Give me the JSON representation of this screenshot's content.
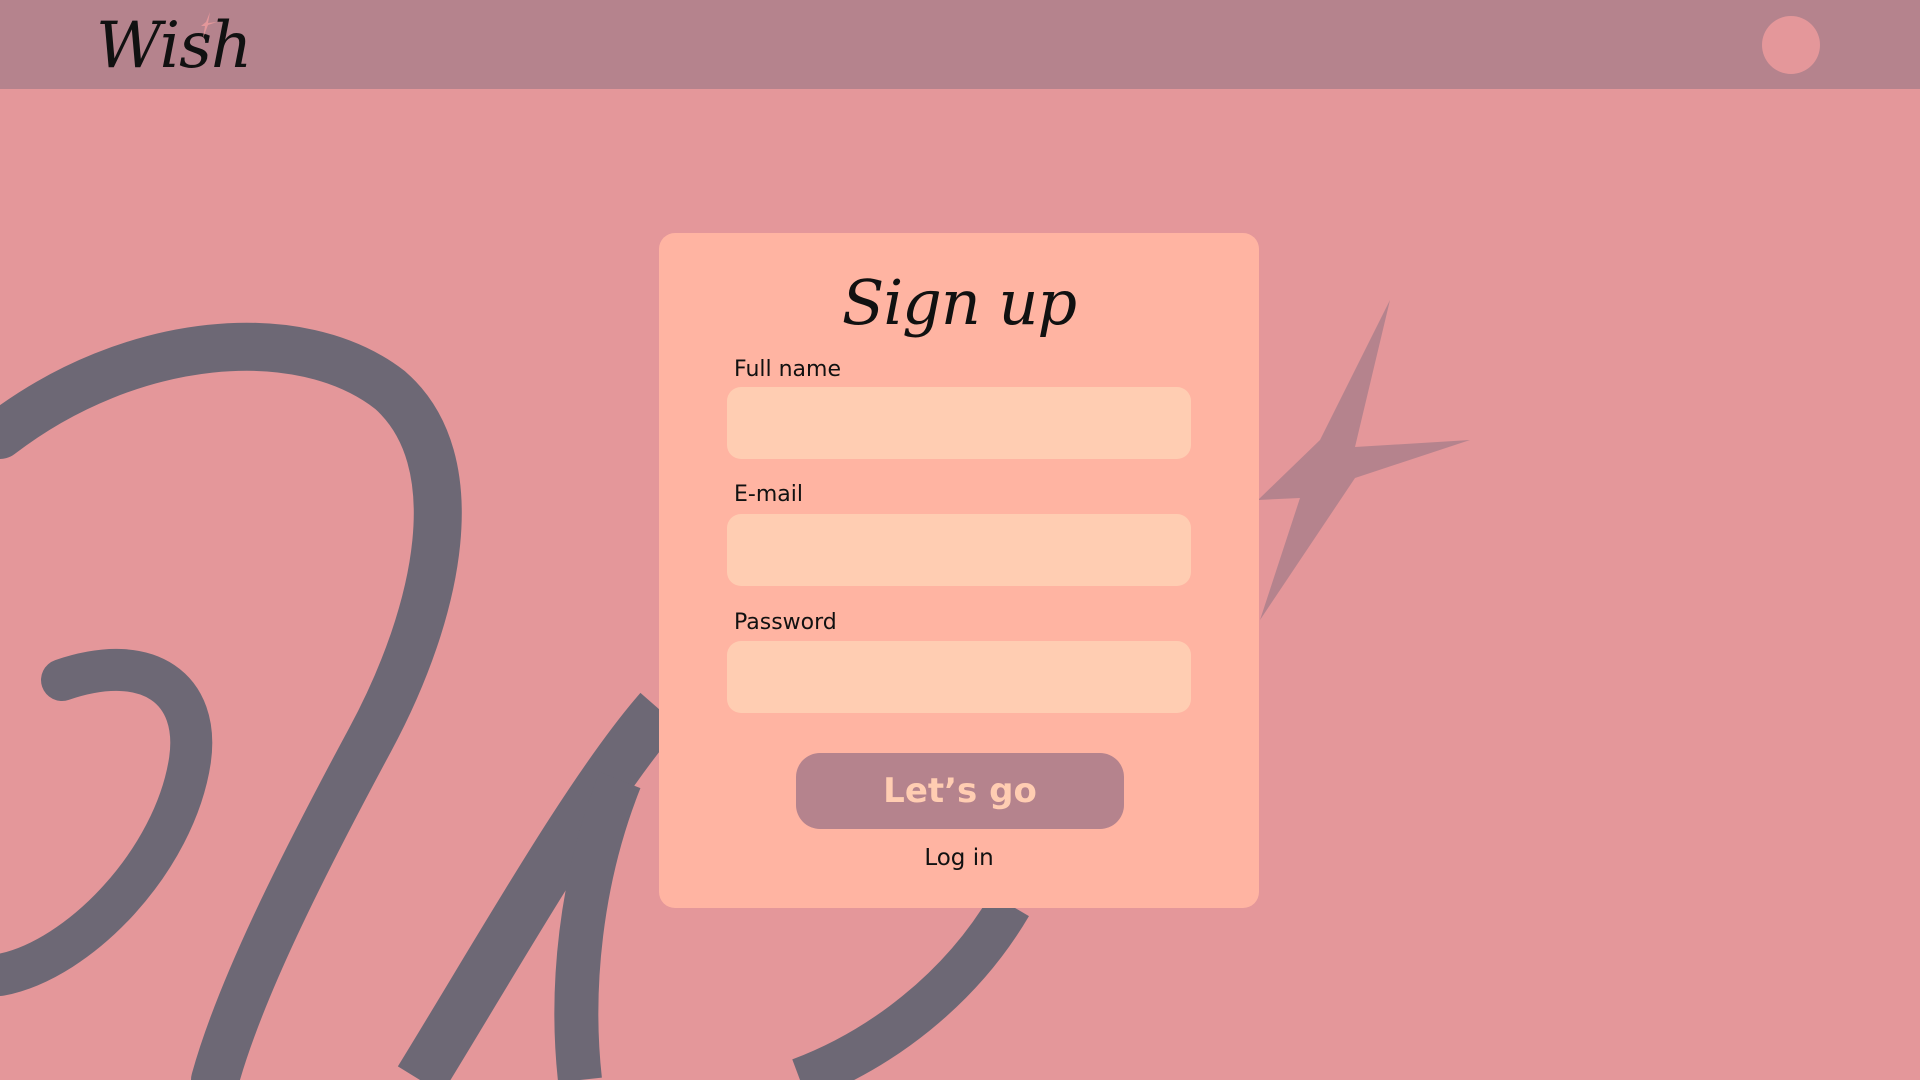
{
  "header": {
    "logo_text": "Wish"
  },
  "signup": {
    "title": "Sign up",
    "fields": [
      {
        "label": "Full name",
        "value": "",
        "placeholder": ""
      },
      {
        "label": "E-mail",
        "value": "",
        "placeholder": ""
      },
      {
        "label": "Password",
        "value": "",
        "placeholder": ""
      }
    ],
    "submit_label": "Let’s go",
    "login_label": "Log in"
  },
  "icons": {
    "logo_star": "sparkle-star-icon",
    "background_star": "sparkle-star-icon",
    "avatar": "user-avatar"
  },
  "colors": {
    "background": "#e4979a",
    "header": "#b5838d",
    "card": "#ffb4a2",
    "input": "#ffcdb2",
    "button": "#b5838d",
    "button_text": "#ffcdb2",
    "decor_script": "#6d6875",
    "decor_star": "#b5838d"
  }
}
